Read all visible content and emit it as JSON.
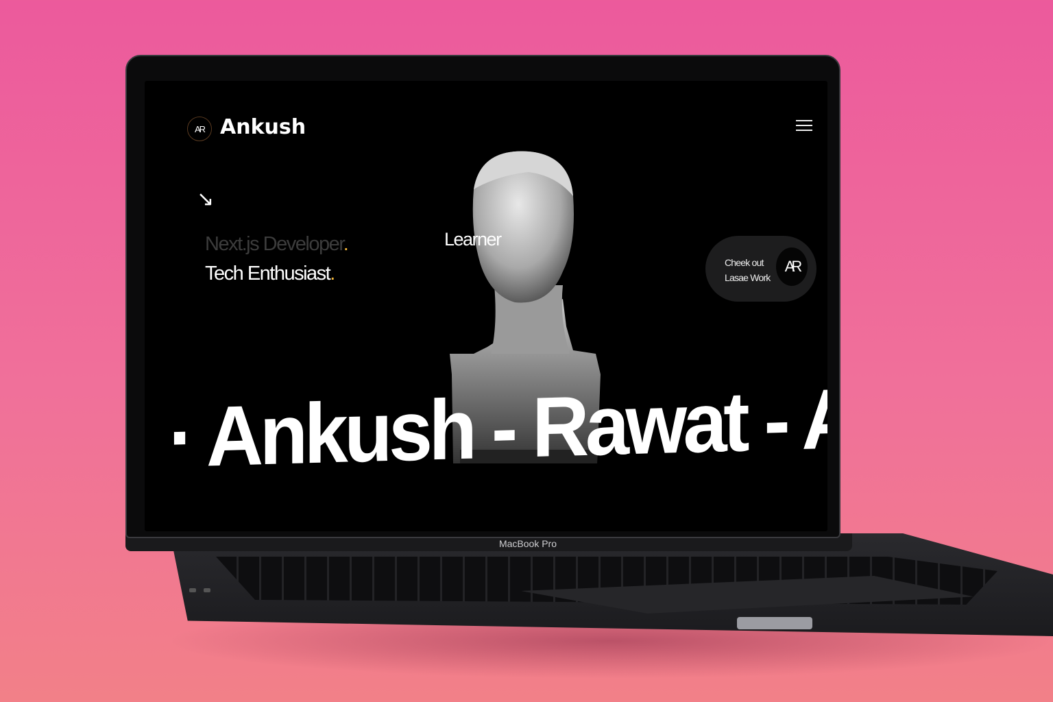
{
  "device": {
    "label": "MacBook Pro"
  },
  "site": {
    "logo_mark": "AR",
    "brand": "Ankush",
    "menu_icon": "hamburger-icon",
    "arrow_icon": "arrow-down-right-icon",
    "roles": {
      "previous": "Next.js Developer",
      "current": "Tech Enthusiast",
      "floating": "Learner"
    },
    "accent_color": "#f5b83a",
    "cta": {
      "line1": "Cheek out",
      "line2": "Lasae Work",
      "logo_mark": "AR"
    },
    "marquee": "· Ankush - Rawat - An"
  }
}
